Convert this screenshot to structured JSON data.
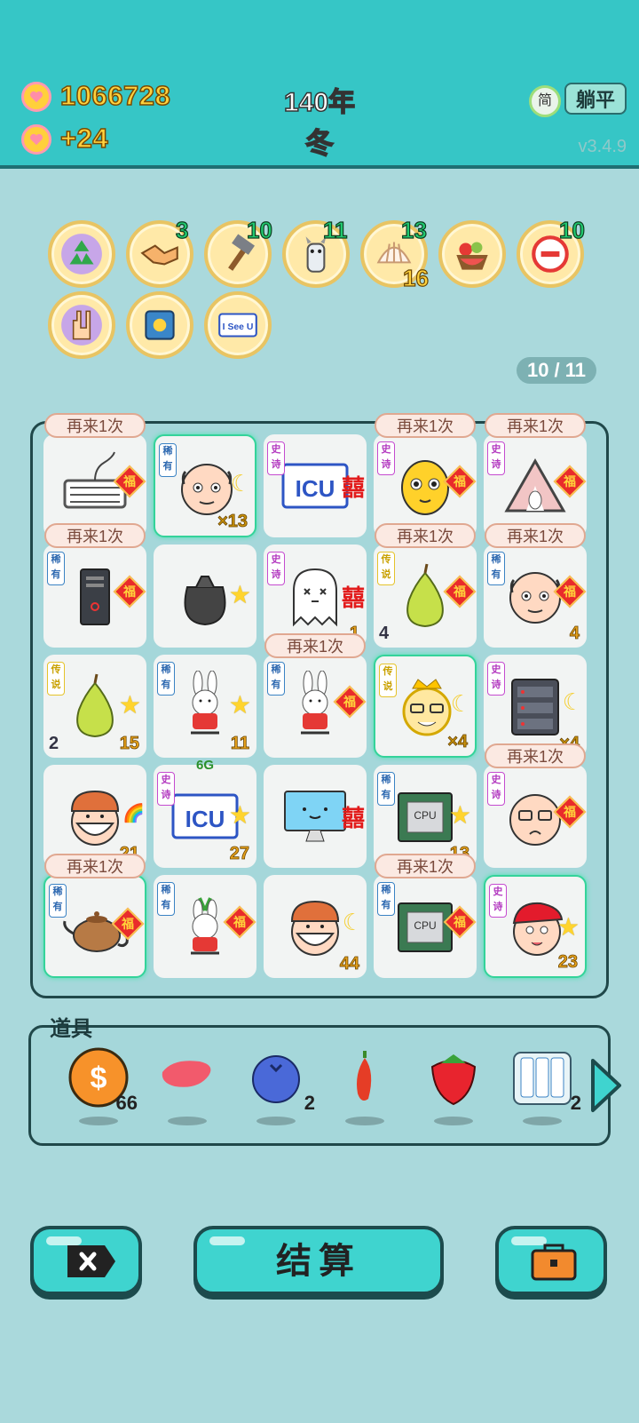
{
  "header": {
    "coins": "1066728",
    "income": "+24",
    "year": "140年",
    "season": "冬",
    "simplified_label": "简",
    "flat_button": "躺平",
    "version": "v3.4.9",
    "coin_icon": "heart-coin-icon"
  },
  "relics": [
    {
      "name": "recycle",
      "count": ""
    },
    {
      "name": "handshake",
      "count": "3"
    },
    {
      "name": "hammer",
      "count": "10"
    },
    {
      "name": "dog",
      "count": "11"
    },
    {
      "name": "shell",
      "count": "13",
      "sub": "16"
    },
    {
      "name": "fruit-basket",
      "count": ""
    },
    {
      "name": "minus",
      "count": "10"
    },
    {
      "name": "rock-hand",
      "count": ""
    },
    {
      "name": "safe",
      "count": ""
    },
    {
      "name": "i-see-u",
      "count": "",
      "text": "I See U"
    }
  ],
  "page": "10 / 11",
  "again_label": "再来1次",
  "rarity_labels": {
    "rare": "稀有",
    "epic": "史诗",
    "legend": "传说"
  },
  "fu": "福",
  "board": [
    {
      "art": "keyboard",
      "rarity": "",
      "badge": "fu",
      "count": "",
      "again": true
    },
    {
      "art": "bald-man",
      "rarity": "rare",
      "badge": "moon",
      "count": "×13",
      "glow": true
    },
    {
      "art": "icu",
      "rarity": "epic",
      "badge": "double",
      "count": "",
      "icu_text": "ICU"
    },
    {
      "art": "yellow-face",
      "rarity": "epic",
      "badge": "fu",
      "count": "",
      "again": true
    },
    {
      "art": "tent-rabbit",
      "rarity": "epic",
      "badge": "fu",
      "count": "",
      "again": true
    },
    {
      "art": "computer-tower",
      "rarity": "rare",
      "badge": "fu",
      "count": "",
      "again": true
    },
    {
      "art": "trash-bag",
      "rarity": "",
      "badge": "star",
      "count": ""
    },
    {
      "art": "ghost",
      "rarity": "epic",
      "badge": "double",
      "count": "1"
    },
    {
      "art": "pear",
      "rarity": "legend",
      "badge": "fu",
      "count_left": "4",
      "again": true
    },
    {
      "art": "bald-man",
      "rarity": "rare",
      "badge": "fu",
      "count": "4",
      "again": true
    },
    {
      "art": "pear",
      "rarity": "legend",
      "badge": "star",
      "count": "15",
      "count_left": "2"
    },
    {
      "art": "rabbit",
      "rarity": "rare",
      "badge": "star",
      "count": "11"
    },
    {
      "art": "rabbit",
      "rarity": "rare",
      "badge": "fu",
      "count": "",
      "again": true
    },
    {
      "art": "king",
      "rarity": "legend",
      "badge": "moon",
      "count": "×4",
      "glow": true
    },
    {
      "art": "server",
      "rarity": "epic",
      "badge": "moon",
      "count": "×4"
    },
    {
      "art": "masked-worker",
      "rarity": "",
      "badge": "rainbow",
      "count": "21"
    },
    {
      "art": "icu",
      "rarity": "epic",
      "badge": "star",
      "count": "27",
      "top": "6G",
      "icu_text": "ICU"
    },
    {
      "art": "monitor",
      "rarity": "",
      "badge": "double",
      "count": ""
    },
    {
      "art": "cpu",
      "rarity": "rare",
      "badge": "star",
      "count": "13",
      "cpu_text": "CPU"
    },
    {
      "art": "glasses-man",
      "rarity": "epic",
      "badge": "fu",
      "count": "",
      "again": true
    },
    {
      "art": "teapot",
      "rarity": "rare",
      "badge": "fu",
      "count": "",
      "again": true,
      "glow": true
    },
    {
      "art": "rabbit-sprout",
      "rarity": "rare",
      "badge": "fu",
      "count": ""
    },
    {
      "art": "masked-worker",
      "rarity": "",
      "badge": "moon",
      "count": "44"
    },
    {
      "art": "cpu",
      "rarity": "rare",
      "badge": "fu",
      "count": "",
      "again": true,
      "cpu_text": "CPU"
    },
    {
      "art": "red-hat-boy",
      "rarity": "epic",
      "badge": "star",
      "count": "23",
      "glow": true
    }
  ],
  "items": {
    "title": "道具",
    "list": [
      {
        "name": "dollar-coin",
        "qty": "66",
        "symbol": "$"
      },
      {
        "name": "liver",
        "qty": ""
      },
      {
        "name": "blueberry",
        "qty": "2"
      },
      {
        "name": "chili",
        "qty": ""
      },
      {
        "name": "strawberry",
        "qty": ""
      },
      {
        "name": "rare-cards",
        "qty": "2"
      }
    ]
  },
  "buttons": {
    "delete_icon": "delete-icon",
    "settle": "结算",
    "bag_icon": "briefcase-icon"
  },
  "colors": {
    "header": "#36c6c6",
    "background": "#aad9dc",
    "accent": "#3fd4cf",
    "gold": "#ffd23e",
    "green_count": "#21c86f"
  }
}
